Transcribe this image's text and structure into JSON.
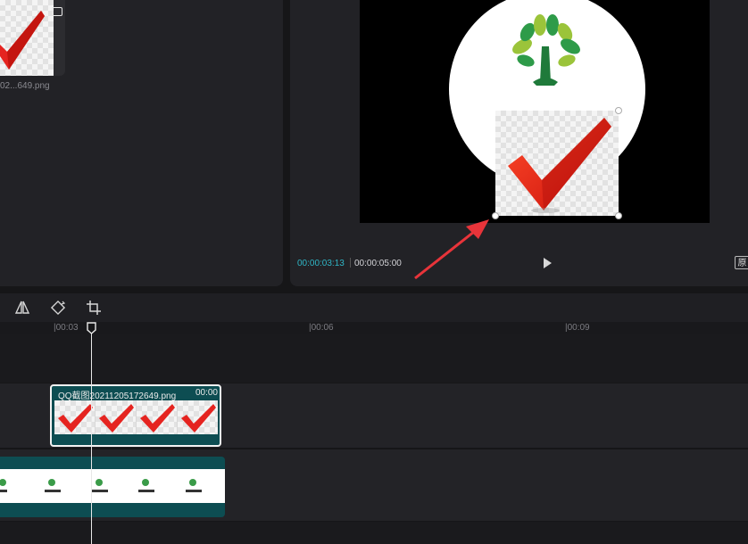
{
  "media": {
    "item_label": "02...649.png"
  },
  "player": {
    "current_time": "00:00:03:13",
    "total_time": "00:00:05:00",
    "ratio_label": "原"
  },
  "timeline": {
    "ruler_ticks": [
      "|00:03",
      "|00:06",
      "|00:09"
    ],
    "overlay_clip": {
      "title": "QQ截图20211205172649.png",
      "duration": "00:00"
    }
  },
  "colors": {
    "accent_time": "#2fb6c6",
    "clip_teal": "#0d4d52",
    "annotation_arrow": "#e8343a"
  }
}
